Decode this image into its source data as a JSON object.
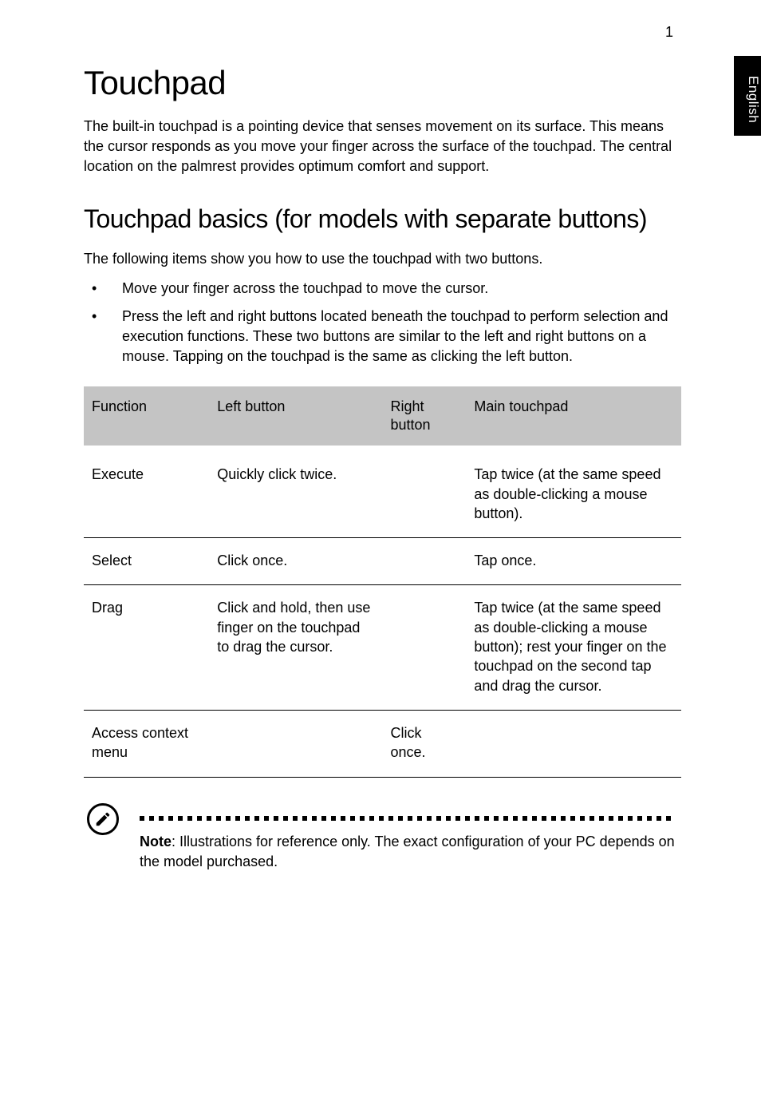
{
  "page_number": "1",
  "side_tab": "English",
  "heading1": "Touchpad",
  "intro": "The built-in touchpad is a pointing device that senses movement on its surface. This means the cursor responds as you move your finger across the surface of the touchpad. The central location on the palmrest provides optimum comfort and support.",
  "heading2": "Touchpad basics (for models with separate buttons)",
  "section_text": "The following items show you how to use the touchpad with two buttons.",
  "bullets": [
    "Move your finger across the touchpad to move the cursor.",
    "Press the left and right buttons located beneath the touchpad to perform selection and execution functions. These two buttons are similar to the left and right buttons on a mouse. Tapping on the touchpad is the same as clicking the left button."
  ],
  "table": {
    "headers": {
      "col1": "Function",
      "col2": "Left button",
      "col3": "Right button",
      "col4": "Main touchpad"
    },
    "rows": [
      {
        "function": "Execute",
        "left": "Quickly click twice.",
        "right": "",
        "main": "Tap twice (at the same speed as double-clicking a mouse button)."
      },
      {
        "function": "Select",
        "left": "Click once.",
        "right": "",
        "main": "Tap once."
      },
      {
        "function": "Drag",
        "left": "Click and hold, then use finger on the touchpad to drag the cursor.",
        "right": "",
        "main": "Tap twice (at the same speed as double-clicking a mouse button); rest your finger on the touchpad on the second tap and drag the cursor."
      },
      {
        "function": "Access context menu",
        "left": "",
        "right": "Click once.",
        "main": ""
      }
    ]
  },
  "note_label": "Note",
  "note_text": ": Illustrations for reference only. The exact configuration of your PC depends on the model purchased."
}
